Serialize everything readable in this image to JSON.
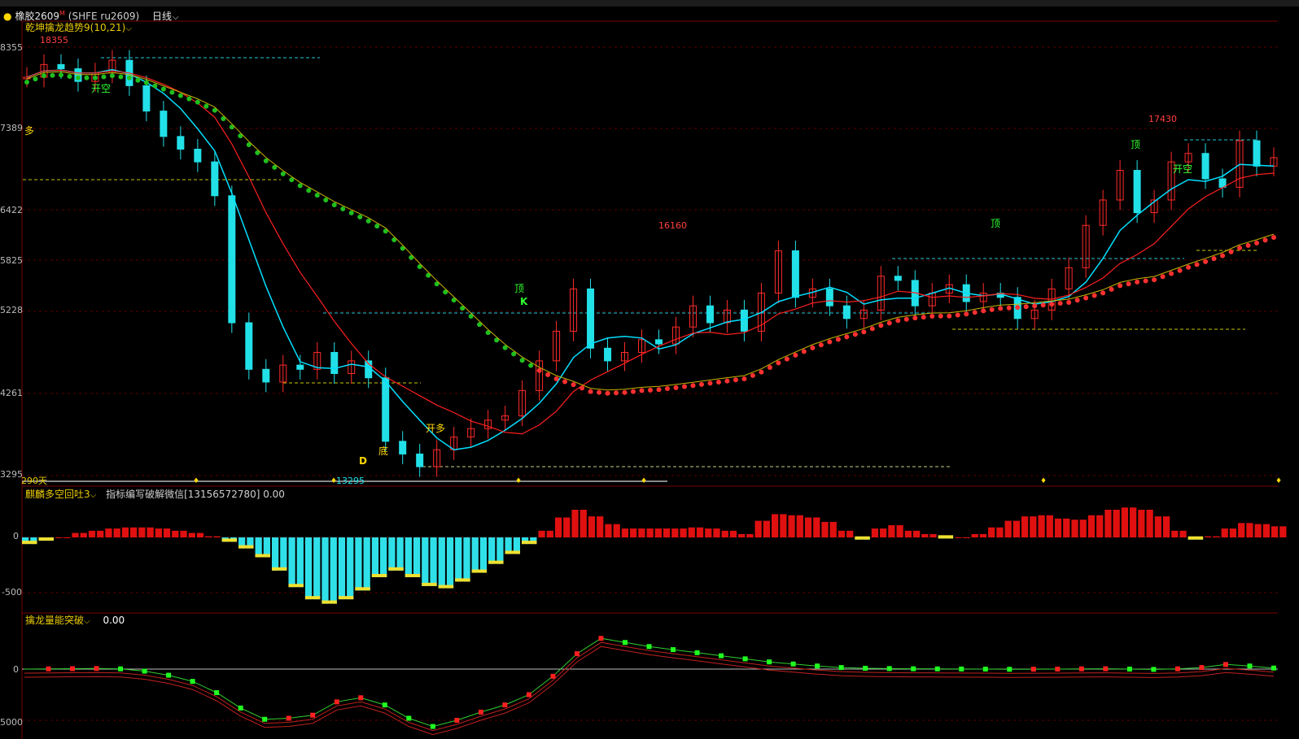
{
  "header": {
    "symbol": "橡胶2609",
    "badge": "M",
    "code": "(SHFE ru2609)",
    "period": "日线"
  },
  "colors": {
    "up": "#ff2a2a",
    "down": "#22e0e8",
    "grid": "#5a0000",
    "ma_fast": "#00e0ff",
    "ma_slow": "#ff2020",
    "band_green": "#1fbf1f",
    "band_red": "#ff3030",
    "label_yellow": "#ffd700",
    "label_red": "#ff4040",
    "label_green": "#30ff30"
  },
  "main_panel": {
    "title": "乾坤擒龙趋势9(10,21)",
    "days_label": "290天",
    "y_ticks": [
      "8355",
      "7389",
      "6422",
      "5825",
      "5228",
      "4261",
      "3295"
    ],
    "annotations": {
      "high_left": "18355",
      "high_mid": "16160",
      "high_right": "17430",
      "low": "13295",
      "kai_kong_1": "开空",
      "kai_kong_2": "开空",
      "kai_duo": "开多",
      "duo": "多",
      "ding_1": "顶",
      "ding_2": "顶",
      "ding_3": "顶",
      "di": "底",
      "d_mark": "D",
      "k_mark": "K"
    }
  },
  "mid_panel": {
    "title": "麒麟多空回吐3",
    "subtitle": "指标编写破解微信[13156572780] 0.00",
    "y_ticks": [
      "0",
      "-500"
    ]
  },
  "bottom_panel": {
    "title": "擒龙量能突破",
    "value": "0.00",
    "y_ticks": [
      "0",
      "5000"
    ]
  },
  "chart_data": [
    {
      "type": "candlestick",
      "title": "乾坤擒龙趋势9(10,21)",
      "symbol": "橡胶2609 (SHFE ru2609)",
      "period": "日线",
      "ylim": [
        13295,
        18355
      ],
      "y_ticks": [
        "8355",
        "7389",
        "6422",
        "5825",
        "5228",
        "4261",
        "3295"
      ],
      "close_series": [
        18000,
        18150,
        18100,
        17950,
        18050,
        18200,
        17900,
        17600,
        17300,
        17150,
        17000,
        16600,
        15100,
        14550,
        14400,
        14600,
        14550,
        14750,
        14500,
        14650,
        14450,
        13700,
        13550,
        13400,
        13600,
        13750,
        13850,
        13950,
        14000,
        14300,
        14650,
        15000,
        15500,
        14800,
        14650,
        14750,
        14900,
        14850,
        15050,
        15300,
        15100,
        15250,
        15000,
        15450,
        15950,
        15400,
        15500,
        15300,
        15150,
        15250,
        15650,
        15600,
        15300,
        15450,
        15550,
        15350,
        15450,
        15400,
        15150,
        15250,
        15500,
        15750,
        16250,
        16550,
        16900,
        16400,
        16550,
        17000,
        17100,
        16800,
        16700,
        17250,
        16950,
        17050
      ],
      "annotations": [
        {
          "label": "18355",
          "y": 18355
        },
        {
          "label": "16160",
          "y": 16160
        },
        {
          "label": "17430",
          "y": 17430
        },
        {
          "label": "13295",
          "y": 13295
        }
      ]
    },
    {
      "type": "bar",
      "title": "麒麟多空回吐3",
      "y_ticks": [
        "0",
        "-500"
      ],
      "ylim": [
        -650,
        300
      ],
      "values": [
        -60,
        -30,
        0,
        40,
        60,
        80,
        90,
        90,
        80,
        60,
        40,
        10,
        -40,
        -100,
        -180,
        -300,
        -450,
        -560,
        -600,
        -560,
        -480,
        -360,
        -300,
        -360,
        -440,
        -460,
        -400,
        -320,
        -240,
        -150,
        -60,
        60,
        180,
        250,
        190,
        120,
        80,
        80,
        80,
        80,
        90,
        80,
        60,
        30,
        150,
        210,
        200,
        180,
        140,
        60,
        -20,
        80,
        110,
        60,
        30,
        -10,
        0,
        30,
        90,
        150,
        190,
        200,
        170,
        160,
        200,
        250,
        270,
        250,
        190,
        60,
        -20,
        10,
        80,
        130,
        120,
        100
      ]
    },
    {
      "type": "line",
      "title": "擒龙量能突破",
      "y_ticks": [
        "0",
        "5000"
      ],
      "ylim": [
        -5800,
        3200
      ],
      "values": [
        0,
        20,
        40,
        60,
        20,
        -200,
        -600,
        -1200,
        -2300,
        -3800,
        -4900,
        -4800,
        -4500,
        -3200,
        -2800,
        -3500,
        -4800,
        -5600,
        -5000,
        -4200,
        -3500,
        -2500,
        -700,
        1500,
        3000,
        2600,
        2200,
        1900,
        1600,
        1300,
        1000,
        700,
        500,
        300,
        150,
        80,
        50,
        30,
        20,
        10,
        0,
        -20,
        -10,
        0,
        20,
        30,
        0,
        -30,
        20,
        150,
        450,
        300,
        100
      ]
    }
  ]
}
